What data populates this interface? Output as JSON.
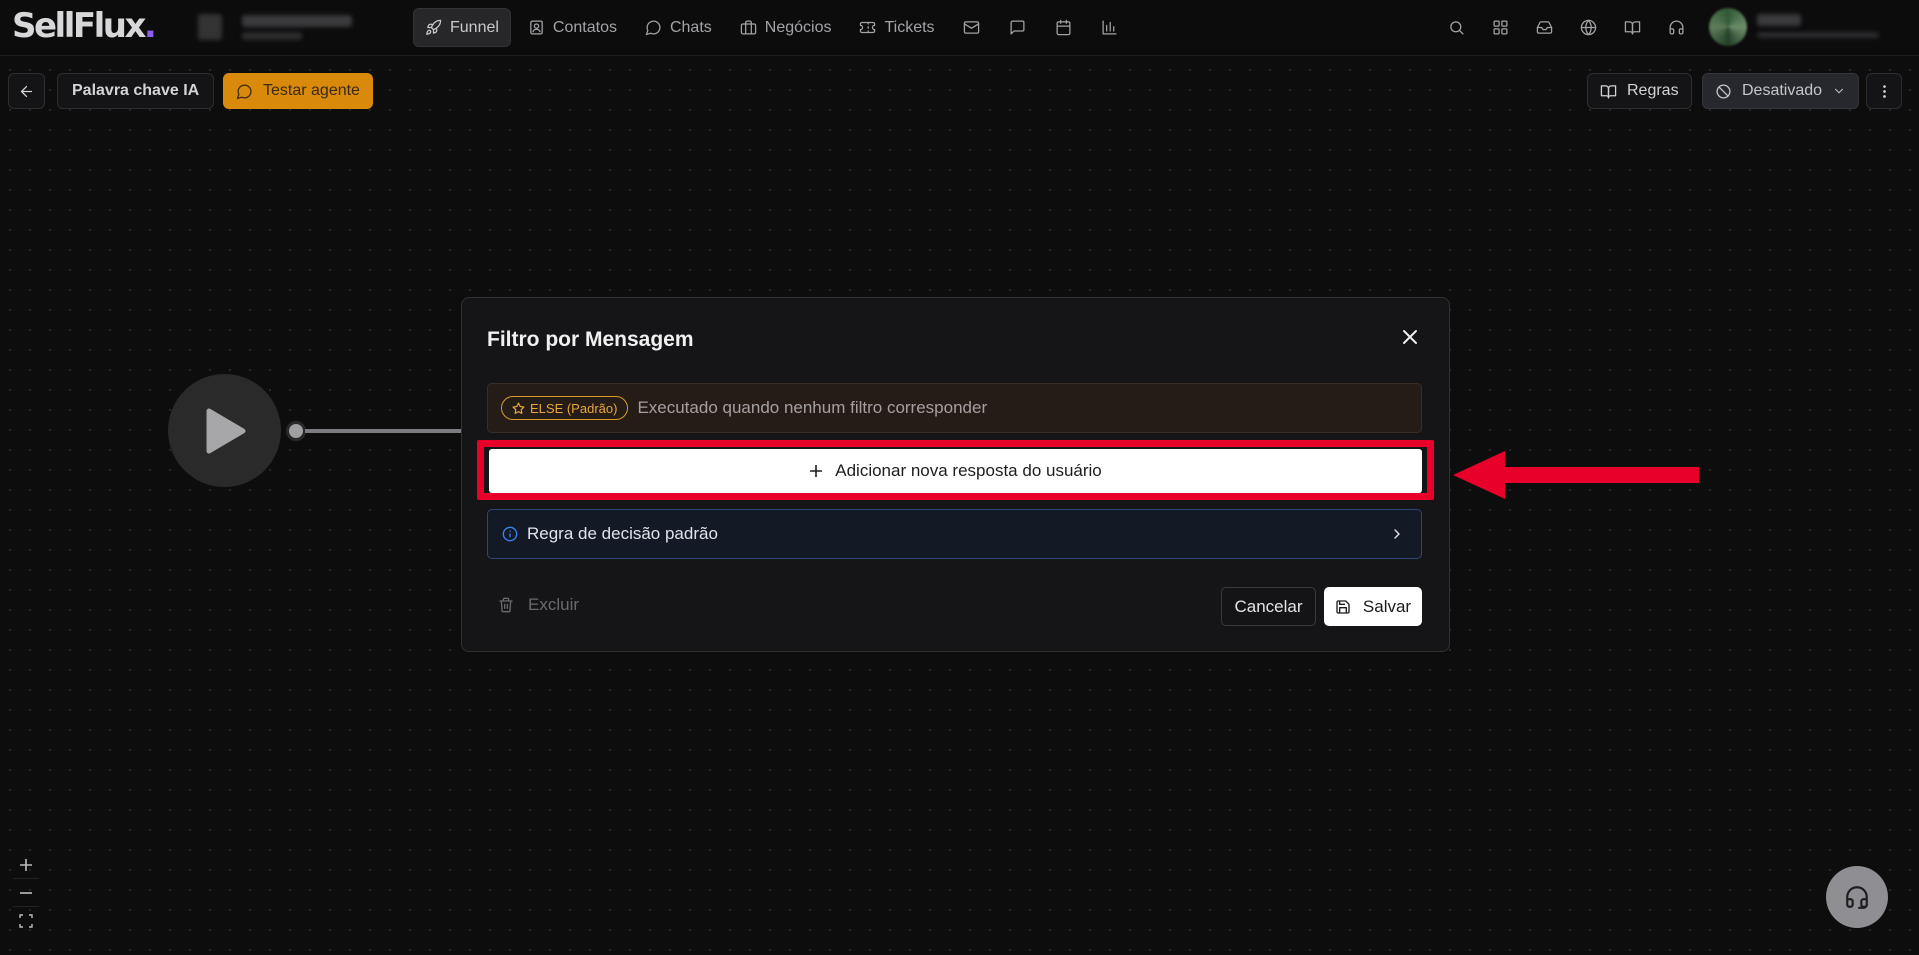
{
  "app": {
    "logo_main": "SellFlux",
    "logo_dot": "."
  },
  "nav": {
    "items": [
      {
        "label": "Funnel",
        "icon": "rocket-icon",
        "active": true
      },
      {
        "label": "Contatos",
        "icon": "contact-icon"
      },
      {
        "label": "Chats",
        "icon": "chat-icon"
      },
      {
        "label": "Negócios",
        "icon": "briefcase-icon"
      },
      {
        "label": "Tickets",
        "icon": "ticket-icon"
      }
    ],
    "icon_items": [
      "mail-icon",
      "message-square-icon",
      "calendar-icon",
      "bar-chart-icon"
    ],
    "right_icons": [
      "search-icon",
      "grid-icon",
      "inbox-icon",
      "globe-icon",
      "book-icon",
      "headset-icon"
    ]
  },
  "toolbar": {
    "back_icon": "arrow-left-icon",
    "flow_name": "Palavra chave IA",
    "test_agent_label": "Testar agente",
    "rules_label": "Regras",
    "status_label": "Desativado",
    "more_icon": "more-vertical-icon"
  },
  "modal": {
    "title": "Filtro por Mensagem",
    "else_badge": "ELSE (Padrão)",
    "else_description": "Executado quando nenhum filtro corresponder",
    "add_button_label": "Adicionar nova resposta do usuário",
    "default_rule_label": "Regra de decisão padrão",
    "delete_label": "Excluir",
    "cancel_label": "Cancelar",
    "save_label": "Salvar"
  },
  "colors": {
    "accent_orange": "#d98a0b",
    "highlight_red": "#e8002a",
    "info_blue": "#3b82f6"
  }
}
